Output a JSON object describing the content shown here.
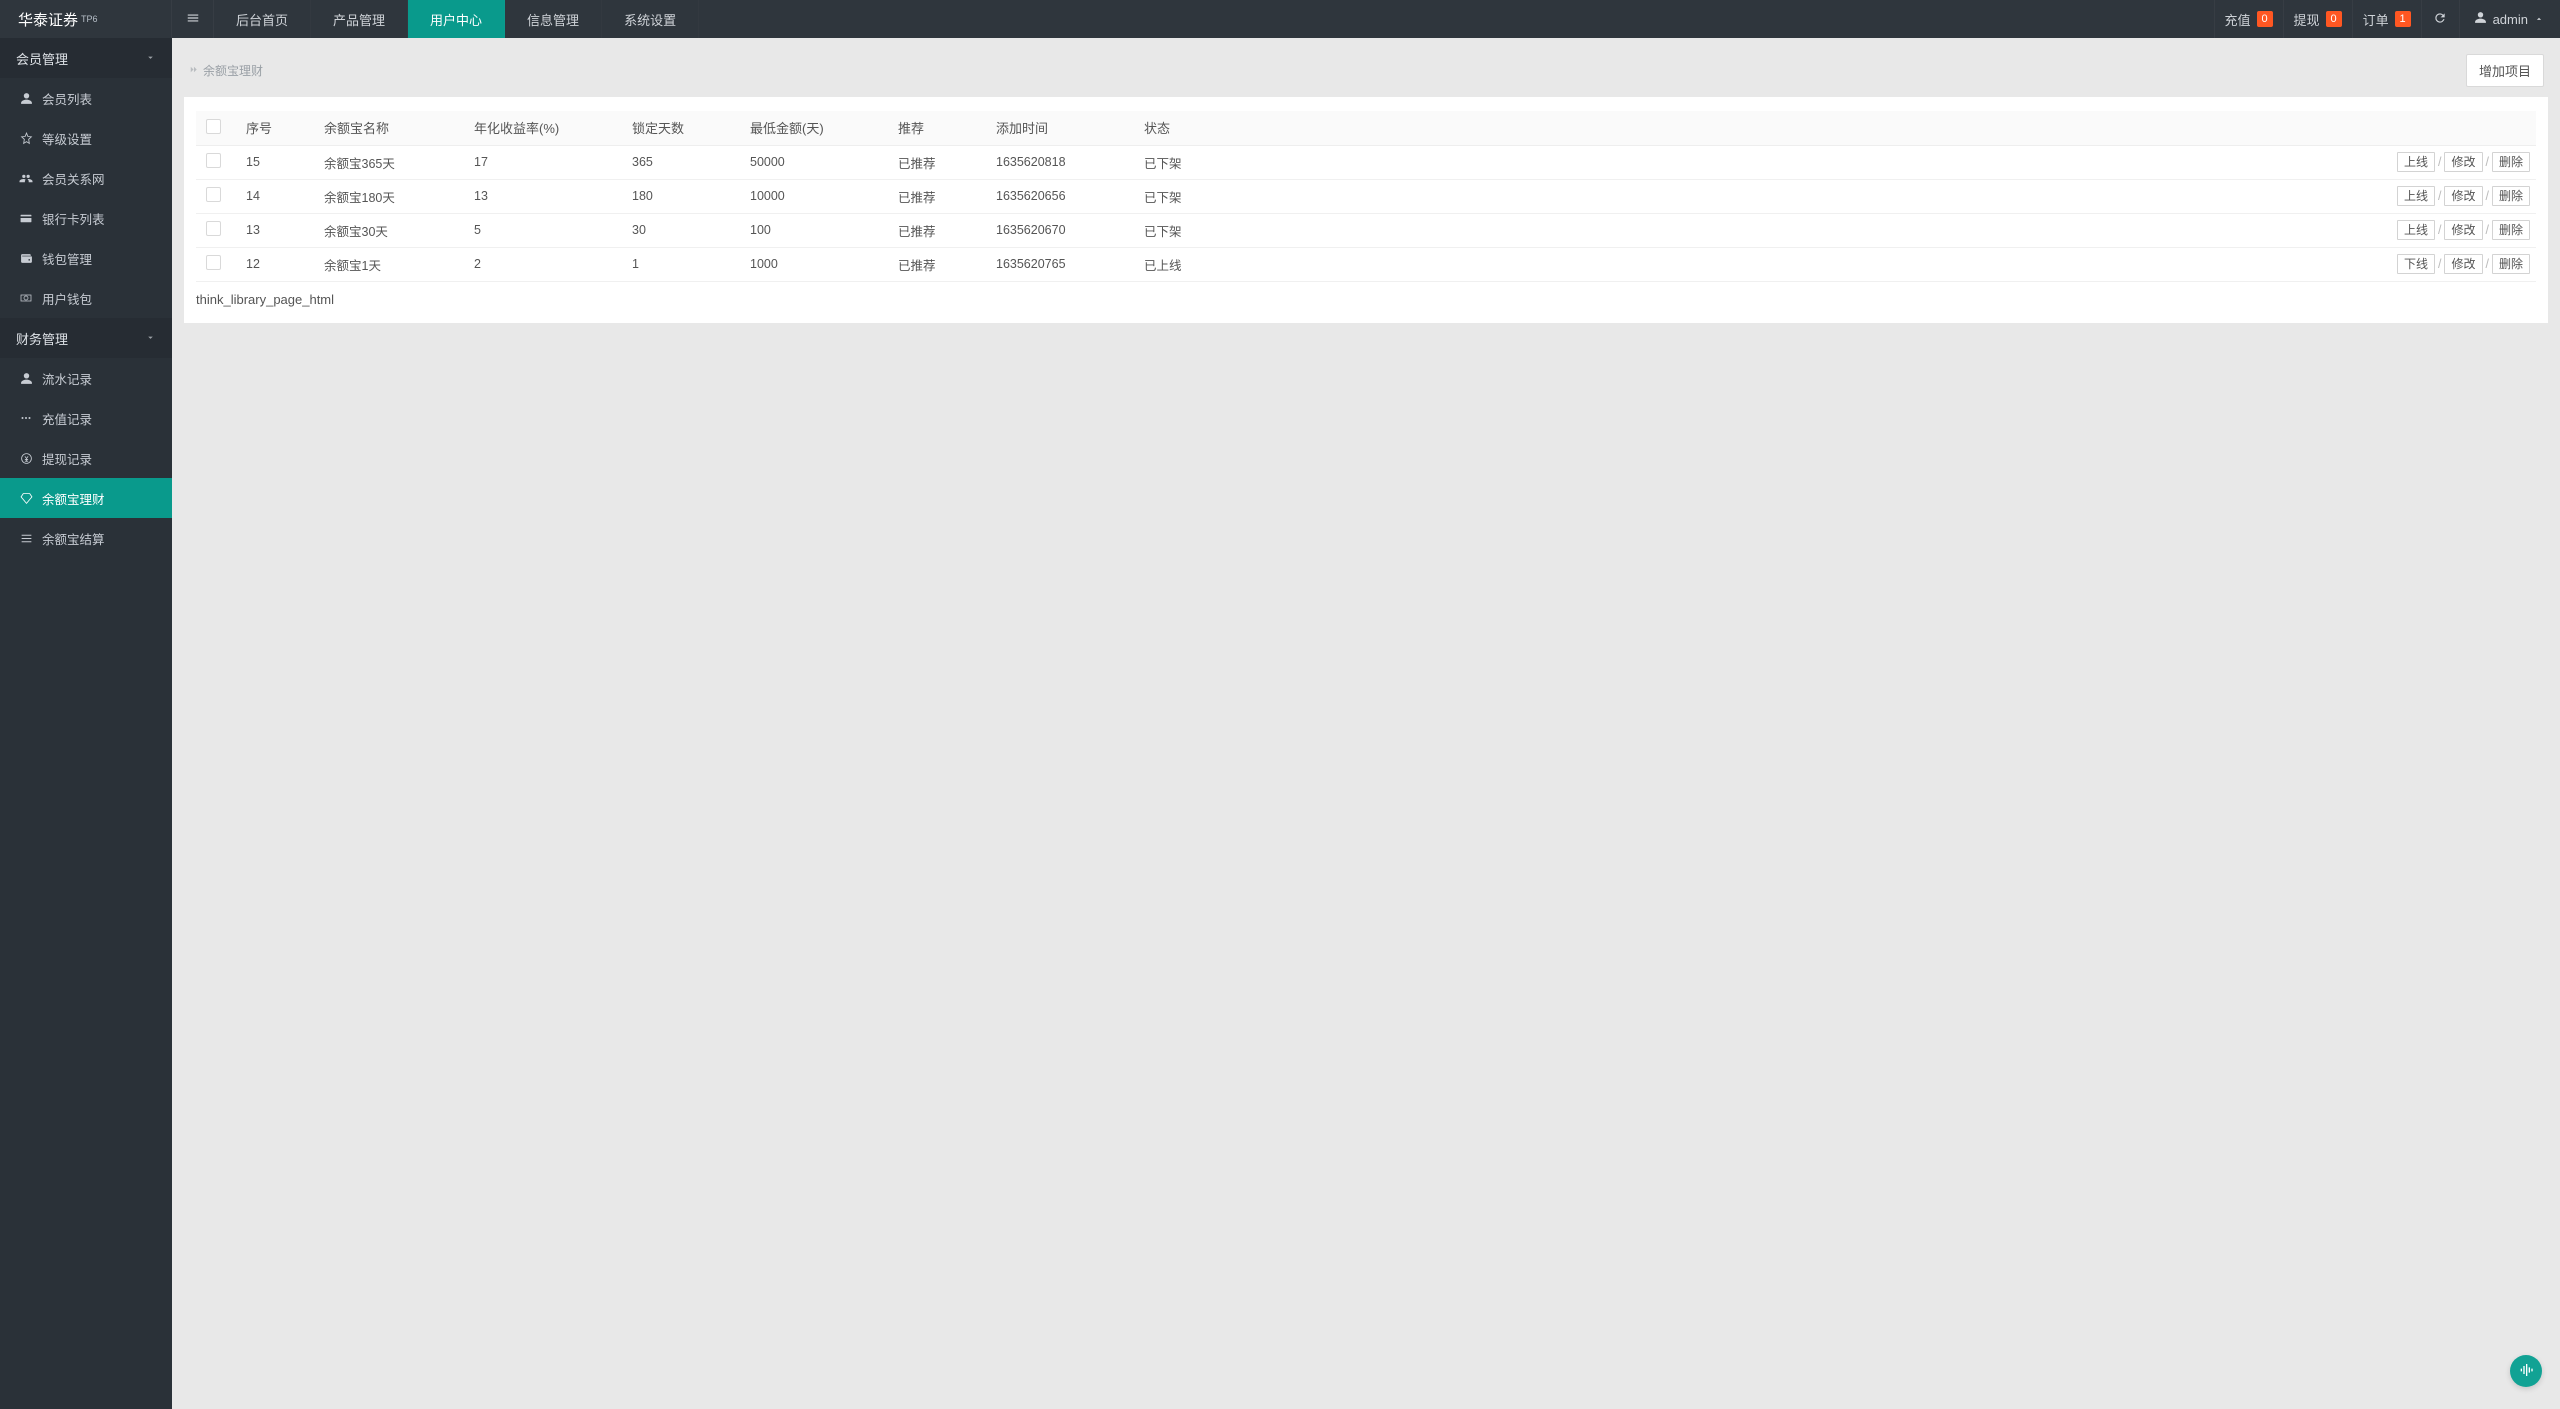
{
  "brand": {
    "name": "华泰证券",
    "sup": "TP6"
  },
  "topnav": [
    {
      "key": "home",
      "label": "后台首页",
      "active": false
    },
    {
      "key": "product",
      "label": "产品管理",
      "active": false
    },
    {
      "key": "user",
      "label": "用户中心",
      "active": true
    },
    {
      "key": "info",
      "label": "信息管理",
      "active": false
    },
    {
      "key": "system",
      "label": "系统设置",
      "active": false
    }
  ],
  "topActions": {
    "recharge": {
      "label": "充值",
      "count": "0",
      "color": "red"
    },
    "withdraw": {
      "label": "提现",
      "count": "0",
      "color": "red"
    },
    "order": {
      "label": "订单",
      "count": "1",
      "color": "red"
    }
  },
  "user": {
    "name": "admin"
  },
  "sidebar": {
    "groups": [
      {
        "title": "会员管理",
        "items": [
          {
            "key": "member-list",
            "icon": "user",
            "label": "会员列表"
          },
          {
            "key": "level-set",
            "icon": "star",
            "label": "等级设置"
          },
          {
            "key": "relation-net",
            "icon": "users",
            "label": "会员关系网"
          },
          {
            "key": "bankcard-list",
            "icon": "card",
            "label": "银行卡列表"
          },
          {
            "key": "wallet-manage",
            "icon": "wallet",
            "label": "钱包管理"
          },
          {
            "key": "user-wallet",
            "icon": "money",
            "label": "用户钱包"
          }
        ]
      },
      {
        "title": "财务管理",
        "items": [
          {
            "key": "flow-record",
            "icon": "user",
            "label": "流水记录"
          },
          {
            "key": "recharge-record",
            "icon": "dots",
            "label": "充值记录"
          },
          {
            "key": "withdraw-record",
            "icon": "coin",
            "label": "提现记录"
          },
          {
            "key": "yuebao-product",
            "icon": "diamond",
            "label": "余额宝理财",
            "active": true
          },
          {
            "key": "yuebao-settle",
            "icon": "list",
            "label": "余额宝结算"
          }
        ]
      }
    ]
  },
  "breadcrumb": {
    "text": "余额宝理财"
  },
  "buttons": {
    "add": "增加项目"
  },
  "table": {
    "headers": {
      "id": "序号",
      "name": "余额宝名称",
      "rate": "年化收益率(%)",
      "lock": "锁定天数",
      "min": "最低金额(天)",
      "rec": "推荐",
      "time": "添加时间",
      "status": "状态"
    },
    "rows": [
      {
        "id": "15",
        "name": "余额宝365天",
        "rate": "17",
        "lock": "365",
        "min": "50000",
        "rec": "已推荐",
        "time": "1635620818",
        "status": "已下架",
        "toggle": "上线"
      },
      {
        "id": "14",
        "name": "余额宝180天",
        "rate": "13",
        "lock": "180",
        "min": "10000",
        "rec": "已推荐",
        "time": "1635620656",
        "status": "已下架",
        "toggle": "上线"
      },
      {
        "id": "13",
        "name": "余额宝30天",
        "rate": "5",
        "lock": "30",
        "min": "100",
        "rec": "已推荐",
        "time": "1635620670",
        "status": "已下架",
        "toggle": "上线"
      },
      {
        "id": "12",
        "name": "余额宝1天",
        "rate": "2",
        "lock": "1",
        "min": "1000",
        "rec": "已推荐",
        "time": "1635620765",
        "status": "已上线",
        "toggle": "下线"
      }
    ],
    "rowActions": {
      "edit": "修改",
      "delete": "删除"
    }
  },
  "pager": {
    "text": "think_library_page_html"
  }
}
